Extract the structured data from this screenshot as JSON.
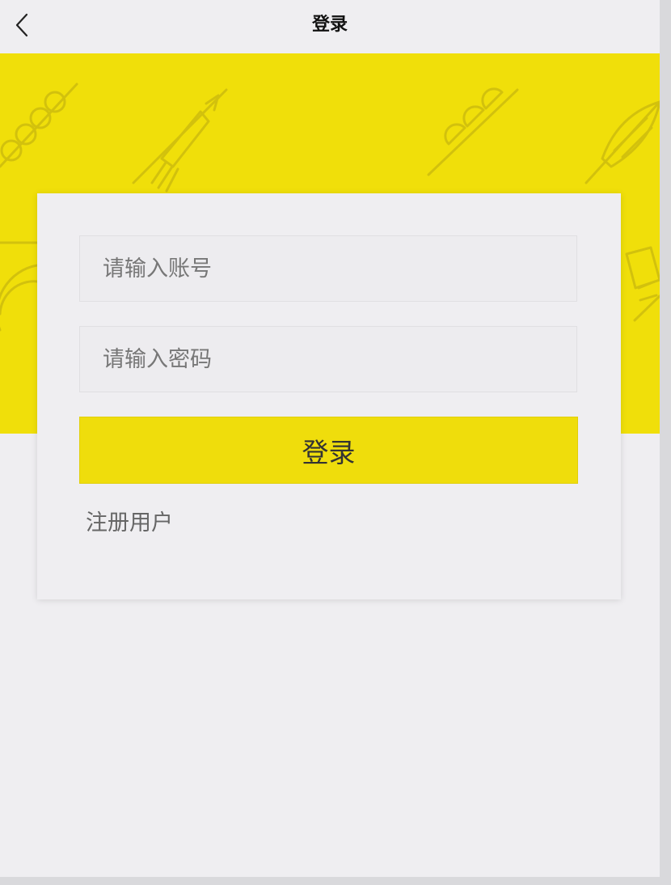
{
  "header": {
    "title": "登录",
    "back_icon": "chevron-left-icon"
  },
  "banner": {
    "color": "#f0df0a",
    "pattern": "skewer-illustrations"
  },
  "login_form": {
    "account_placeholder": "请输入账号",
    "password_placeholder": "请输入密码",
    "submit_label": "登录",
    "register_label": "注册用户"
  },
  "colors": {
    "accent": "#efdd0c",
    "background": "#efeef1"
  }
}
